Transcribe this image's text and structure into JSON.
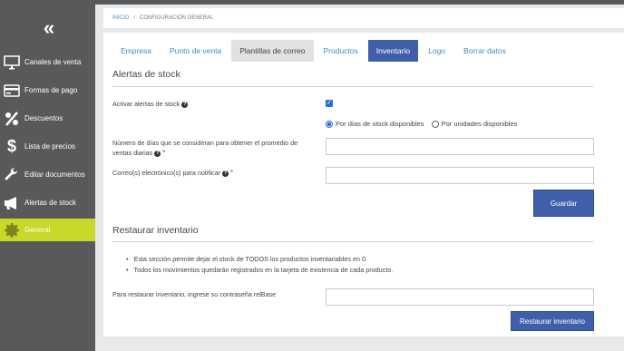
{
  "sidebar": {
    "toggle": "«",
    "items": [
      {
        "label": "Canales de venta",
        "icon": "monitor-icon"
      },
      {
        "label": "Formas de pago",
        "icon": "credit-card-icon"
      },
      {
        "label": "Descuentos",
        "icon": "percent-icon"
      },
      {
        "label": "Lista de precios",
        "icon": "dollar-icon"
      },
      {
        "label": "Editar documentos",
        "icon": "wrench-icon"
      },
      {
        "label": "Alertas de stock",
        "icon": "megaphone-icon"
      },
      {
        "label": "General",
        "icon": "gear-icon",
        "active": true
      }
    ]
  },
  "breadcrumb": {
    "home": "INICIO",
    "separator": "/",
    "current": "CONFIGURACIÓN GENERAL"
  },
  "tabs": [
    "Empresa",
    "Punto de venta",
    "Plantillas de correo",
    "Productos",
    "Inventario",
    "Logo",
    "Borrar datos"
  ],
  "alerts": {
    "title": "Alertas de stock",
    "activate_label": "Activar alertas de stock",
    "radio_days": "Por días de stock disponibles",
    "radio_units": "Por unidades disponibles",
    "days_label_line1": "Número de días que se consideran para obtener el promedio de",
    "days_label_line2": "ventas diarias",
    "email_label": "Correo(s) electrónico(s) para notificar",
    "save_button": "Guardar"
  },
  "restore": {
    "title": "Restaurar inventario",
    "bullet1": "Esta sección permite dejar el stock de TODOS los productos inventariables en 0.",
    "bullet2": "Todos los movimientos quedarán registrados en la tarjeta de existencia de cada producto.",
    "password_label": "Para restaurar inventario, ingrese su contraseña relBase",
    "button": "Restaurar inventario"
  },
  "colors": {
    "sidebar": "#58595b",
    "active_item": "#c9d82a",
    "primary": "#3f5fa8",
    "link": "#3b8ec7"
  }
}
